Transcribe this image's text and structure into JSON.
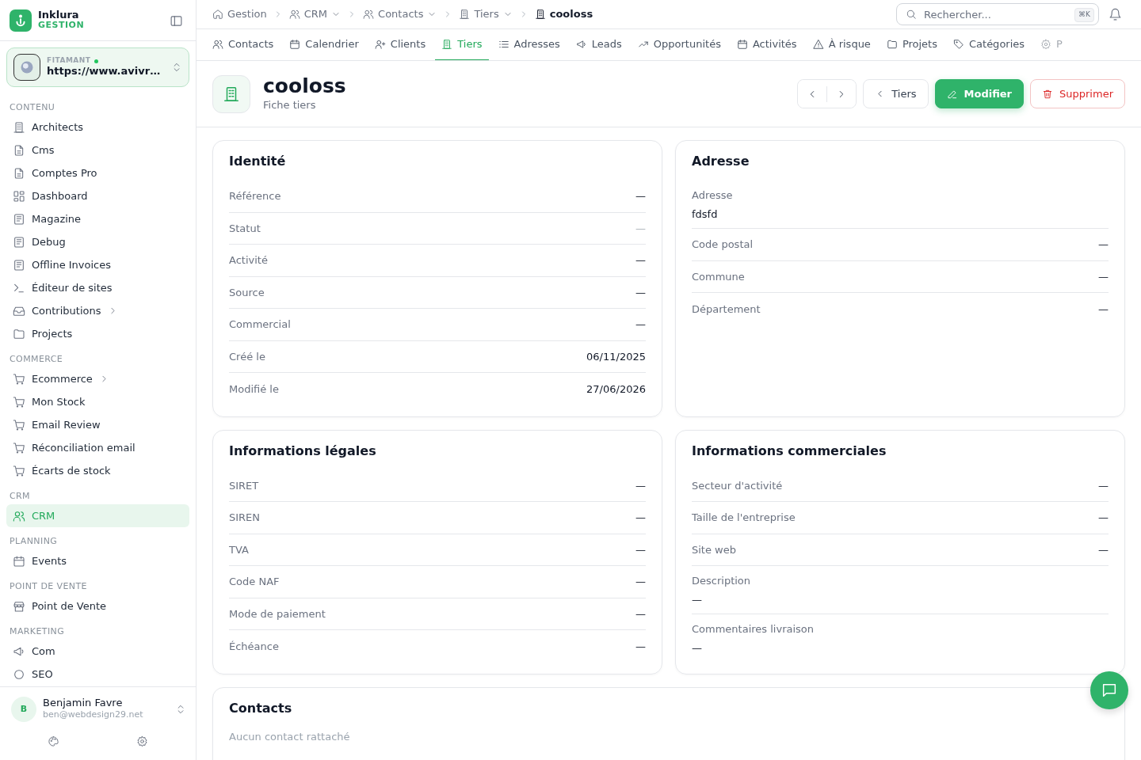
{
  "sidebar": {
    "brand": {
      "name": "Inklura",
      "subtitle": "GESTION"
    },
    "workspace": {
      "label": "FITAMANT",
      "online": true,
      "url": "https://www.avivr…"
    },
    "sections": [
      {
        "title": "CONTENU",
        "items": [
          {
            "label": "Architects",
            "selected": false,
            "expandable": false
          },
          {
            "label": "Cms",
            "selected": false,
            "expandable": false
          },
          {
            "label": "Comptes Pro",
            "selected": false,
            "expandable": false
          },
          {
            "label": "Dashboard",
            "selected": false,
            "expandable": false
          },
          {
            "label": "Magazine",
            "selected": false,
            "expandable": false
          },
          {
            "label": "Debug",
            "selected": false,
            "expandable": false
          },
          {
            "label": "Offline Invoices",
            "selected": false,
            "expandable": false
          },
          {
            "label": "Éditeur de sites",
            "selected": false,
            "expandable": false
          },
          {
            "label": "Contributions",
            "selected": false,
            "expandable": true
          },
          {
            "label": "Projects",
            "selected": false,
            "expandable": false
          }
        ]
      },
      {
        "title": "COMMERCE",
        "items": [
          {
            "label": "Ecommerce",
            "selected": false,
            "expandable": true
          },
          {
            "label": "Mon Stock",
            "selected": false,
            "expandable": false
          },
          {
            "label": "Email Review",
            "selected": false,
            "expandable": false
          },
          {
            "label": "Réconciliation email",
            "selected": false,
            "expandable": false
          },
          {
            "label": "Écarts de stock",
            "selected": false,
            "expandable": false
          }
        ]
      },
      {
        "title": "CRM",
        "items": [
          {
            "label": "CRM",
            "selected": true,
            "expandable": false
          }
        ]
      },
      {
        "title": "PLANNING",
        "items": [
          {
            "label": "Events",
            "selected": false,
            "expandable": false
          }
        ]
      },
      {
        "title": "POINT DE VENTE",
        "items": [
          {
            "label": "Point de Vente",
            "selected": false,
            "expandable": false
          }
        ]
      },
      {
        "title": "MARKETING",
        "items": [
          {
            "label": "Com",
            "selected": false,
            "expandable": false
          },
          {
            "label": "SEO",
            "selected": false,
            "expandable": false
          }
        ]
      }
    ],
    "user": {
      "initial": "B",
      "name": "Benjamin Favre",
      "email": "ben@webdesign29.net"
    }
  },
  "breadcrumb": [
    {
      "label": "Gestion",
      "dropdown": false,
      "current": false
    },
    {
      "label": "CRM",
      "dropdown": true,
      "current": false
    },
    {
      "label": "Contacts",
      "dropdown": true,
      "current": false
    },
    {
      "label": "Tiers",
      "dropdown": true,
      "current": false
    },
    {
      "label": "cooloss",
      "dropdown": false,
      "current": true
    }
  ],
  "search": {
    "placeholder": "Rechercher...",
    "shortcut": "⌘K"
  },
  "tabs": [
    {
      "label": "Contacts",
      "selected": false
    },
    {
      "label": "Calendrier",
      "selected": false
    },
    {
      "label": "Clients",
      "selected": false
    },
    {
      "label": "Tiers",
      "selected": true
    },
    {
      "label": "Adresses",
      "selected": false
    },
    {
      "label": "Leads",
      "selected": false
    },
    {
      "label": "Opportunités",
      "selected": false
    },
    {
      "label": "Activités",
      "selected": false
    },
    {
      "label": "À risque",
      "selected": false
    },
    {
      "label": "Projets",
      "selected": false
    },
    {
      "label": "Catégories",
      "selected": false
    },
    {
      "label": "P",
      "selected": false
    }
  ],
  "header": {
    "title": "cooloss",
    "subtitle": "Fiche tiers",
    "back_label": "Tiers",
    "edit_label": "Modifier",
    "delete_label": "Supprimer"
  },
  "cards": [
    {
      "title": "Identité",
      "fields": [
        {
          "kind": "inline",
          "label": "Référence",
          "value": "—"
        },
        {
          "kind": "status",
          "label": "Statut",
          "value": "—"
        },
        {
          "kind": "inline",
          "label": "Activité",
          "value": "—"
        },
        {
          "kind": "inline",
          "label": "Source",
          "value": "—"
        },
        {
          "kind": "inline",
          "label": "Commercial",
          "value": "—"
        },
        {
          "kind": "inline",
          "label": "Créé le",
          "value": "06/11/2025"
        },
        {
          "kind": "inline",
          "label": "Modifié le",
          "value": "27/06/2026"
        }
      ]
    },
    {
      "title": "Adresse",
      "fields": [
        {
          "kind": "stacked",
          "label": "Adresse",
          "value": "fdsfd"
        },
        {
          "kind": "inline",
          "label": "Code postal",
          "value": "—"
        },
        {
          "kind": "inline",
          "label": "Commune",
          "value": "—"
        },
        {
          "kind": "inline",
          "label": "Département",
          "value": "—"
        }
      ]
    },
    {
      "title": "Informations légales",
      "fields": [
        {
          "kind": "inline",
          "label": "SIRET",
          "value": "—"
        },
        {
          "kind": "inline",
          "label": "SIREN",
          "value": "—"
        },
        {
          "kind": "inline",
          "label": "TVA",
          "value": "—"
        },
        {
          "kind": "inline",
          "label": "Code NAF",
          "value": "—"
        },
        {
          "kind": "inline",
          "label": "Mode de paiement",
          "value": "—"
        },
        {
          "kind": "inline",
          "label": "Échéance",
          "value": "—"
        }
      ]
    },
    {
      "title": "Informations commerciales",
      "fields": [
        {
          "kind": "inline",
          "label": "Secteur d'activité",
          "value": "—"
        },
        {
          "kind": "inline",
          "label": "Taille de l'entreprise",
          "value": "—"
        },
        {
          "kind": "inline",
          "label": "Site web",
          "value": "—"
        },
        {
          "kind": "stacked",
          "label": "Description",
          "value": "—"
        },
        {
          "kind": "stacked",
          "label": "Commentaires livraison",
          "value": "—"
        }
      ]
    }
  ],
  "contacts": {
    "title": "Contacts",
    "empty_text": "Aucun contact rattaché"
  }
}
